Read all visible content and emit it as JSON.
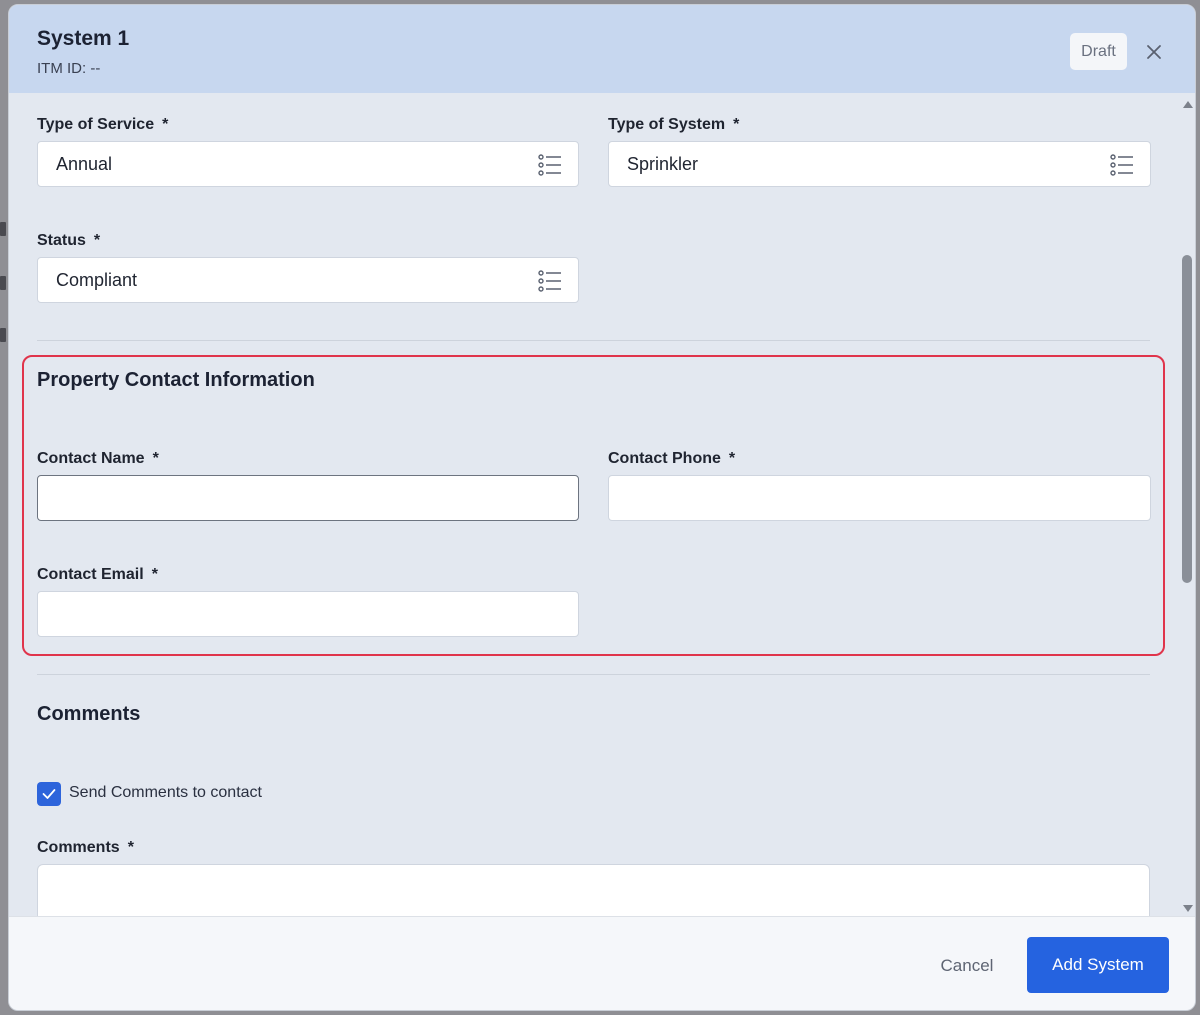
{
  "header": {
    "title": "System 1",
    "itm_id": "ITM ID: --",
    "badge": "Draft"
  },
  "form": {
    "type_of_service": {
      "label": "Type of Service",
      "required": "*",
      "value": "Annual"
    },
    "type_of_system": {
      "label": "Type of System",
      "required": "*",
      "value": "Sprinkler"
    },
    "status": {
      "label": "Status",
      "required": "*",
      "value": "Compliant"
    }
  },
  "property_contact": {
    "title": "Property Contact Information",
    "contact_name": {
      "label": "Contact Name",
      "required": "*",
      "value": ""
    },
    "contact_phone": {
      "label": "Contact Phone",
      "required": "*",
      "value": ""
    },
    "contact_email": {
      "label": "Contact Email",
      "required": "*",
      "value": ""
    }
  },
  "comments": {
    "title": "Comments",
    "send_checkbox_label": "Send Comments to contact",
    "send_checked": true,
    "field_label": "Comments",
    "required": "*",
    "value": ""
  },
  "footer": {
    "cancel_label": "Cancel",
    "add_label": "Add System"
  },
  "colors": {
    "header_bg": "#c7d7ef",
    "primary": "#2563e0",
    "highlight": "#e0344b"
  }
}
